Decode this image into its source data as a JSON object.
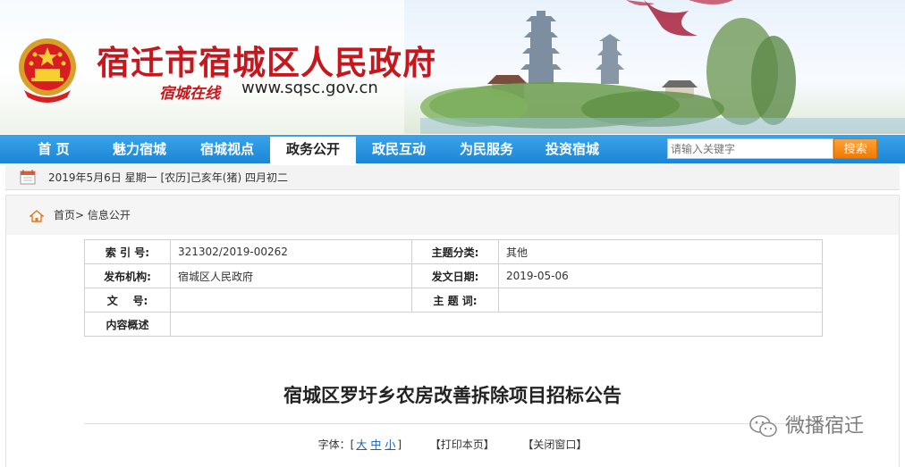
{
  "header": {
    "site_title": "宿迁市宿城区人民政府",
    "slogan": "宿城在线",
    "domain": "www.sqsc.gov.cn"
  },
  "nav": {
    "items": [
      {
        "label": "首  页"
      },
      {
        "label": "魅力宿城"
      },
      {
        "label": "宿城视点"
      },
      {
        "label": "政务公开"
      },
      {
        "label": "政民互动"
      },
      {
        "label": "为民服务"
      },
      {
        "label": "投资宿城"
      }
    ],
    "active_index": 3
  },
  "search": {
    "placeholder": "请输入关键字",
    "button_label": "搜索"
  },
  "date_bar": {
    "text": "2019年5月6日 星期一 [农历]己亥年(猪) 四月初二"
  },
  "breadcrumb": {
    "home": "首页",
    "separator": ">",
    "current": "信息公开"
  },
  "meta": {
    "index_label": "索 引 号:",
    "index_value": "321302/2019-00262",
    "category_label": "主题分类:",
    "category_value": "其他",
    "publisher_label": "发布机构:",
    "publisher_value": "宿城区人民政府",
    "date_label": "发文日期:",
    "date_value": "2019-05-06",
    "docno_label": "文    号:",
    "docno_value": "",
    "keywords_label": "主 题 词:",
    "keywords_value": "",
    "summary_label": "内容概述",
    "summary_value": ""
  },
  "article": {
    "title": "宿城区罗圩乡农房改善拆除项目招标公告"
  },
  "tools": {
    "font_label": "字体：[",
    "large": "大",
    "medium": "中",
    "small": "小",
    "font_end": "]",
    "print": "【打印本页】",
    "close": "【关闭窗口】"
  },
  "watermark": {
    "text": "微播宿迁"
  },
  "colors": {
    "brand_red": "#c8161d",
    "nav_blue": "#1b86d6",
    "search_orange": "#f07a00"
  }
}
